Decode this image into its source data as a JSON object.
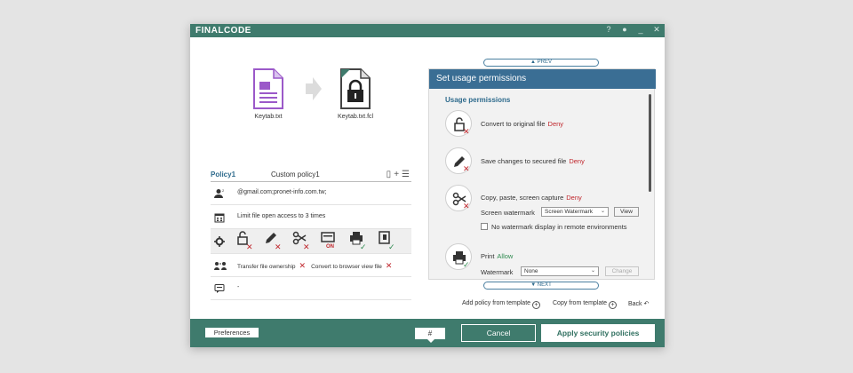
{
  "app": {
    "logo": "FINALCODE",
    "titlebar_icons": [
      "help-icon",
      "user-icon",
      "minimize-icon",
      "close-icon"
    ],
    "accent": "#3f7b6d",
    "header_blue": "#3a6e94"
  },
  "files": {
    "source_name": "Keytab.txt",
    "target_name": "Keytab.txt.fcl"
  },
  "policy": {
    "name": "Policy1",
    "template": "Custom policy1",
    "recipients": "@gmail.com;pronet-info.com.tw;",
    "access_limit": "Limit file open access to 3 times",
    "on_label": "ON",
    "transfer_ownership": "Transfer file ownership",
    "convert_browser": "Convert to browser view file",
    "comment": "-"
  },
  "panel": {
    "prev_label": "PREV",
    "next_label": "NEXT",
    "title": "Set usage permissions",
    "section": "Usage permissions",
    "perms": [
      {
        "label": "Convert to original file",
        "status": "Deny"
      },
      {
        "label": "Save changes to secured file",
        "status": "Deny"
      },
      {
        "label": "Copy, paste, screen capture",
        "status": "Deny"
      },
      {
        "label": "Print",
        "status": "Allow"
      }
    ],
    "screen_watermark_label": "Screen watermark",
    "screen_watermark_value": "Screen Watermark",
    "view_button": "View",
    "no_watermark_label": "No watermark display in remote environments",
    "watermark_label": "Watermark",
    "watermark_value": "None",
    "change_button": "Change"
  },
  "links": {
    "add_policy": "Add policy from template",
    "copy_template": "Copy from template",
    "back": "Back"
  },
  "footer": {
    "preferences": "Preferences",
    "hash": "#",
    "cancel": "Cancel",
    "apply": "Apply security policies"
  }
}
